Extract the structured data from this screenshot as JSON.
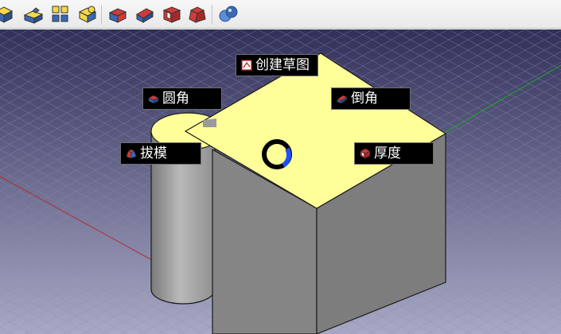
{
  "toolbar": {
    "buttons": [
      {
        "icon": "part-workbench-cube-icon"
      },
      {
        "icon": "part-workbench-wedge-icon"
      },
      {
        "icon": "part-workbench-array-icon"
      },
      {
        "icon": "part-workbench-compound-icon"
      },
      {
        "icon": "fillet-tool-icon"
      },
      {
        "icon": "chamfer-tool-icon"
      },
      {
        "icon": "thickness-tool-icon"
      },
      {
        "icon": "draft-tool-icon"
      },
      {
        "icon": "boolean-spheres-icon"
      }
    ]
  },
  "viewport": {
    "background_top": "#30305a",
    "background_bottom": "#a9a9c6",
    "grid_color": "#8c8cb4",
    "x_axis_color": "#b03030",
    "y_axis_color": "#22aa22",
    "selected_face_color": "#ffff99",
    "side_face_color": "#858585"
  },
  "pie_menu": {
    "items": [
      {
        "label": "创建草图",
        "icon": "create-sketch-icon"
      },
      {
        "label": "圆角",
        "icon": "fillet-icon"
      },
      {
        "label": "倒角",
        "icon": "chamfer-icon"
      },
      {
        "label": "拔模",
        "icon": "draft-icon"
      },
      {
        "label": "厚度",
        "icon": "thickness-icon"
      }
    ]
  }
}
